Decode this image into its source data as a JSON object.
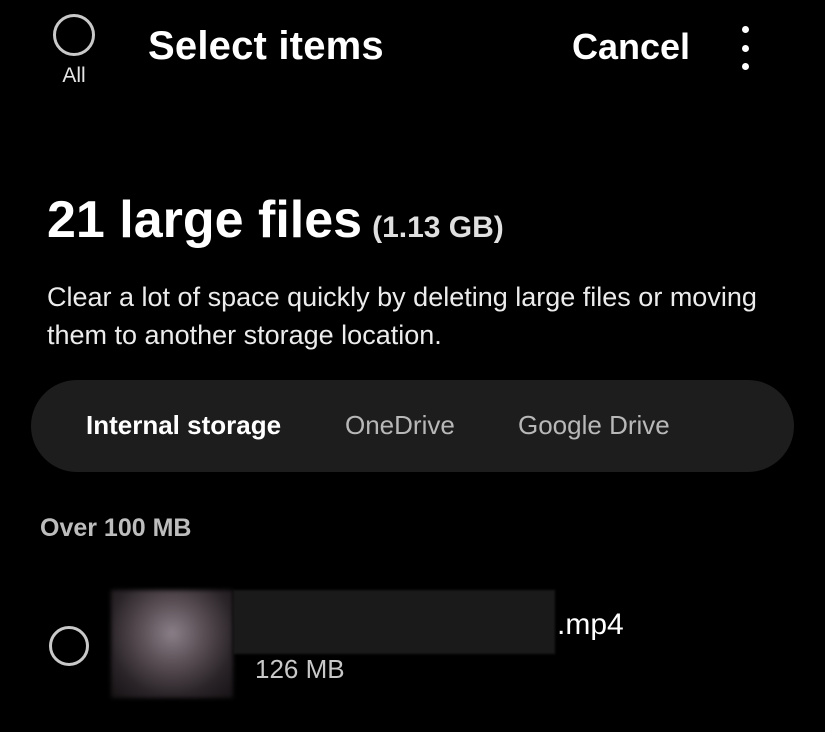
{
  "header": {
    "select_all_label": "All",
    "title": "Select items",
    "cancel_label": "Cancel",
    "more_icon": "more-vertical-icon"
  },
  "summary": {
    "count_text": "21 large files",
    "size_text": "(1.13 GB)",
    "description": "Clear a lot of space quickly by deleting large files or moving them to another storage location."
  },
  "storage_tabs": {
    "items": [
      {
        "label": "Internal storage",
        "selected": true
      },
      {
        "label": "OneDrive",
        "selected": false
      },
      {
        "label": "Google Drive",
        "selected": false
      }
    ]
  },
  "sections": [
    {
      "header": "Over 100 MB",
      "files": [
        {
          "name_suffix": ".mp4",
          "size": "126 MB",
          "selected": false
        }
      ]
    }
  ],
  "colors": {
    "background": "#000000",
    "text_primary": "#ffffff",
    "text_secondary": "#bdbdbd",
    "pill_background": "#1d1d1d",
    "circle_border": "#c9c9c9"
  }
}
